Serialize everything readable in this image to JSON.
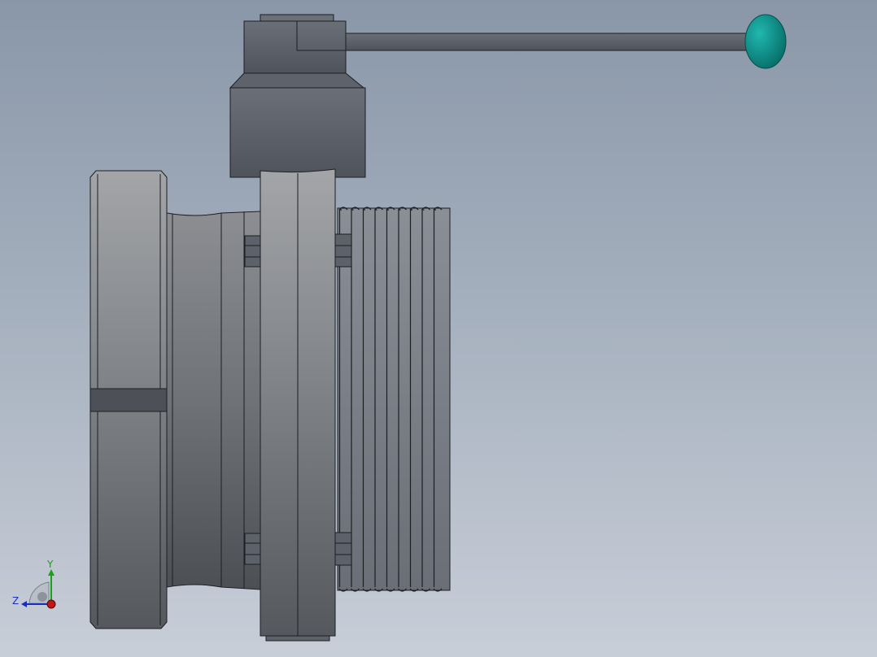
{
  "viewport": {
    "background_top": "#8a97a8",
    "background_bottom": "#c8ced8"
  },
  "model": {
    "body_color": "#5c616a",
    "flange_color": "#8d8f93",
    "edge_color": "#1c1e22",
    "knob_color": "#0e8f8a"
  },
  "triad": {
    "y_label": "Y",
    "z_label": "Z",
    "y_color": "#1aa11a",
    "z_color": "#1a2fbf",
    "x_color": "#c01717"
  }
}
